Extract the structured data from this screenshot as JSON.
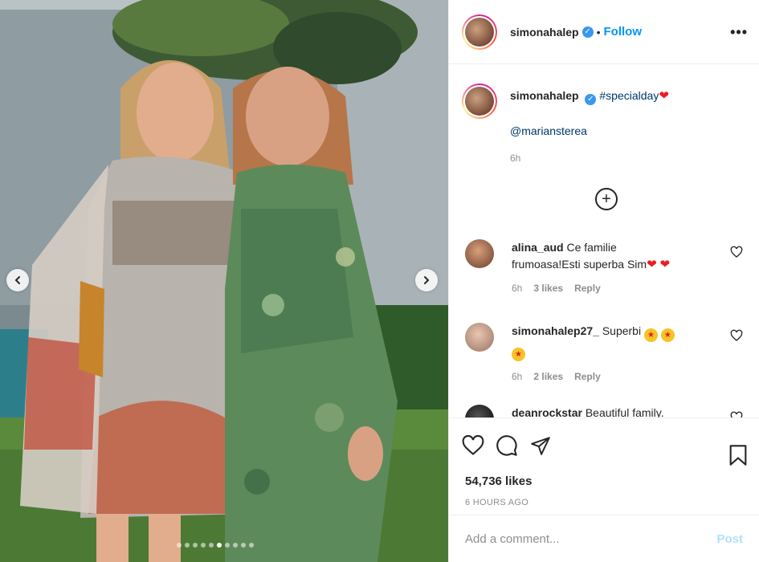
{
  "post": {
    "author": "simonahalep",
    "follow_label": "Follow",
    "separator": "•",
    "more_label": "•••",
    "caption": {
      "hashtag": "#specialday",
      "mention": "@mariansterea",
      "time": "6h"
    },
    "load_more_symbol": "+",
    "image_slides": 10,
    "active_slide": 5
  },
  "comments": [
    {
      "user": "alina_aud",
      "text_line1": "Ce familie",
      "text_line2": "frumoasa!Esti superba Sim",
      "time": "6h",
      "likes": "3 likes",
      "reply": "Reply"
    },
    {
      "user": "simonahalep27_",
      "text": "Superbi",
      "time": "6h",
      "likes": "2 likes",
      "reply": "Reply"
    },
    {
      "user": "deanrockstar",
      "text": "Beautiful family."
    }
  ],
  "actions": {
    "likes_count": "54,736 likes",
    "posted_ago": "6 HOURS AGO"
  },
  "composer": {
    "placeholder": "Add a comment...",
    "post_label": "Post"
  },
  "colors": {
    "accent": "#0095f6",
    "verified": "#3897f0",
    "heart": "#ed1c24",
    "muted": "#8e8e8e"
  }
}
